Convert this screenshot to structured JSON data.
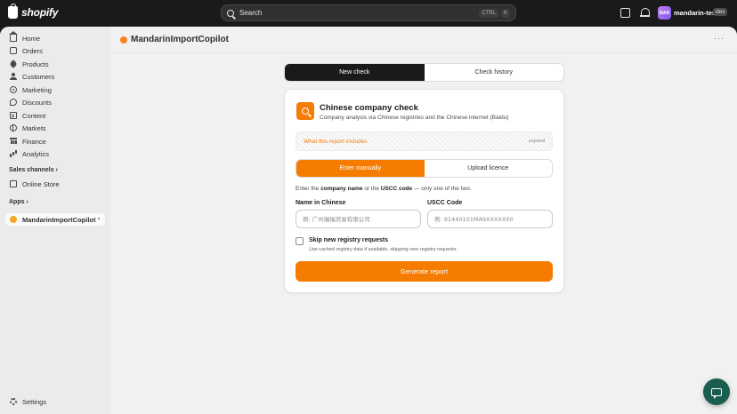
{
  "topbar": {
    "brand": "shopify",
    "search_placeholder": "Search",
    "kbd_ctrl": "CTRL",
    "kbd_k": "K",
    "avatar_initials": "MAR",
    "store_name": "mandarin-test",
    "dev_badge": "dev"
  },
  "sidebar": {
    "items": [
      {
        "label": "Home",
        "icon": "home-icon"
      },
      {
        "label": "Orders",
        "icon": "orders-icon"
      },
      {
        "label": "Products",
        "icon": "tag-icon"
      },
      {
        "label": "Customers",
        "icon": "person-icon"
      },
      {
        "label": "Marketing",
        "icon": "target-icon"
      },
      {
        "label": "Discounts",
        "icon": "discount-icon"
      },
      {
        "label": "Content",
        "icon": "content-icon"
      },
      {
        "label": "Markets",
        "icon": "globe-icon"
      },
      {
        "label": "Finance",
        "icon": "bank-icon"
      },
      {
        "label": "Analytics",
        "icon": "bar-chart-icon"
      }
    ],
    "sales_channels_label": "Sales channels",
    "online_store_label": "Online Store",
    "apps_label": "Apps",
    "active_app_label": "MandarinImportCopilot",
    "settings_label": "Settings"
  },
  "page": {
    "title": "MandarinImportCopilot"
  },
  "tabs": {
    "new_check": "New check",
    "check_history": "Check history"
  },
  "card": {
    "title": "Chinese company check",
    "subtitle": "Company analysis via Chinese registries and the Chinese internet (Baidu)",
    "info_label": "What this report includes",
    "info_expand": "expand",
    "seg_manual": "Enter manually",
    "seg_upload": "Upload licence",
    "hint_prefix": "Enter the ",
    "hint_company": "company name",
    "hint_mid": " or the ",
    "hint_uscc": "USCC code",
    "hint_suffix": " — only one of the two.",
    "name_label": "Name in Chinese",
    "name_placeholder": "例: 广州瑞福贸易有限公司",
    "uscc_label": "USCC Code",
    "uscc_placeholder": "例: 91440101MA9XXXXXX0",
    "skip_label": "Skip new registry requests",
    "skip_sub": "Use cached registry data if available, skipping new registry requests.",
    "generate_label": "Generate report"
  },
  "colors": {
    "accent": "#f57c00",
    "topbar": "#1a1a1a",
    "chat_fab": "#1b5e4f"
  }
}
